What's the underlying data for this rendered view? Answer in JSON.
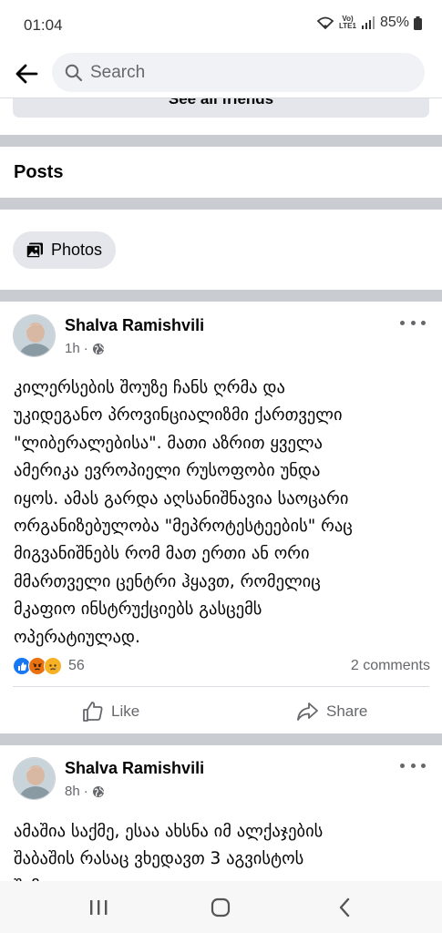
{
  "status_bar": {
    "time": "01:04",
    "network_label_top": "Vo)",
    "network_label_bottom": "LTE1",
    "battery": "85%"
  },
  "search": {
    "placeholder": "Search"
  },
  "friends": {
    "see_all_label": "See all friends"
  },
  "posts_section": {
    "title": "Posts",
    "photos_chip": "Photos"
  },
  "posts": [
    {
      "author": "Shalva Ramishvili",
      "time": "1h",
      "visibility_icon": "globe-icon",
      "lines": [
        "კილერსების შოუზე ჩანს ღრმა და",
        "უკიდეგანო პროვინციალიზმი ქართველი",
        "\"ლიბერალებისა\". მათი აზრით ყველა",
        "ამერიკა ევროპიელი რუსოფობი უნდა",
        "იყოს. ამას გარდა აღსანიშნავია საოცარი",
        "ორგანიზებულობა \"მეპროტესტეების\" რაც",
        "მიგვანიშნებს რომ მათ ერთი ან ორი",
        "მმართველი ცენტრი ჰყავთ, რომელიც",
        "მკაფიო ინსტრუქციებს გასცემს",
        "ოპერატიულად."
      ],
      "reaction_count": "56",
      "reaction_icons": [
        "like-reaction-icon",
        "angry-reaction-icon",
        "sad-reaction-icon"
      ],
      "comments": "2 comments",
      "like_label": "Like",
      "share_label": "Share"
    },
    {
      "author": "Shalva Ramishvili",
      "time": "8h",
      "visibility_icon": "globe-icon",
      "lines": [
        "ამაშია საქმე, ესაა ახსნა იმ ალქაჯების",
        "შაბაშის რასაც ვხედავთ 3 აგვისტოს",
        "შემდეგ"
      ]
    }
  ],
  "colors": {
    "separator": "#c9ccd1",
    "chip_bg": "#e4e6eb",
    "secondary_text": "#65676b",
    "like_blue": "#1877f2",
    "angry_red": "#e9710f",
    "sad_yellow": "#f7b125"
  }
}
